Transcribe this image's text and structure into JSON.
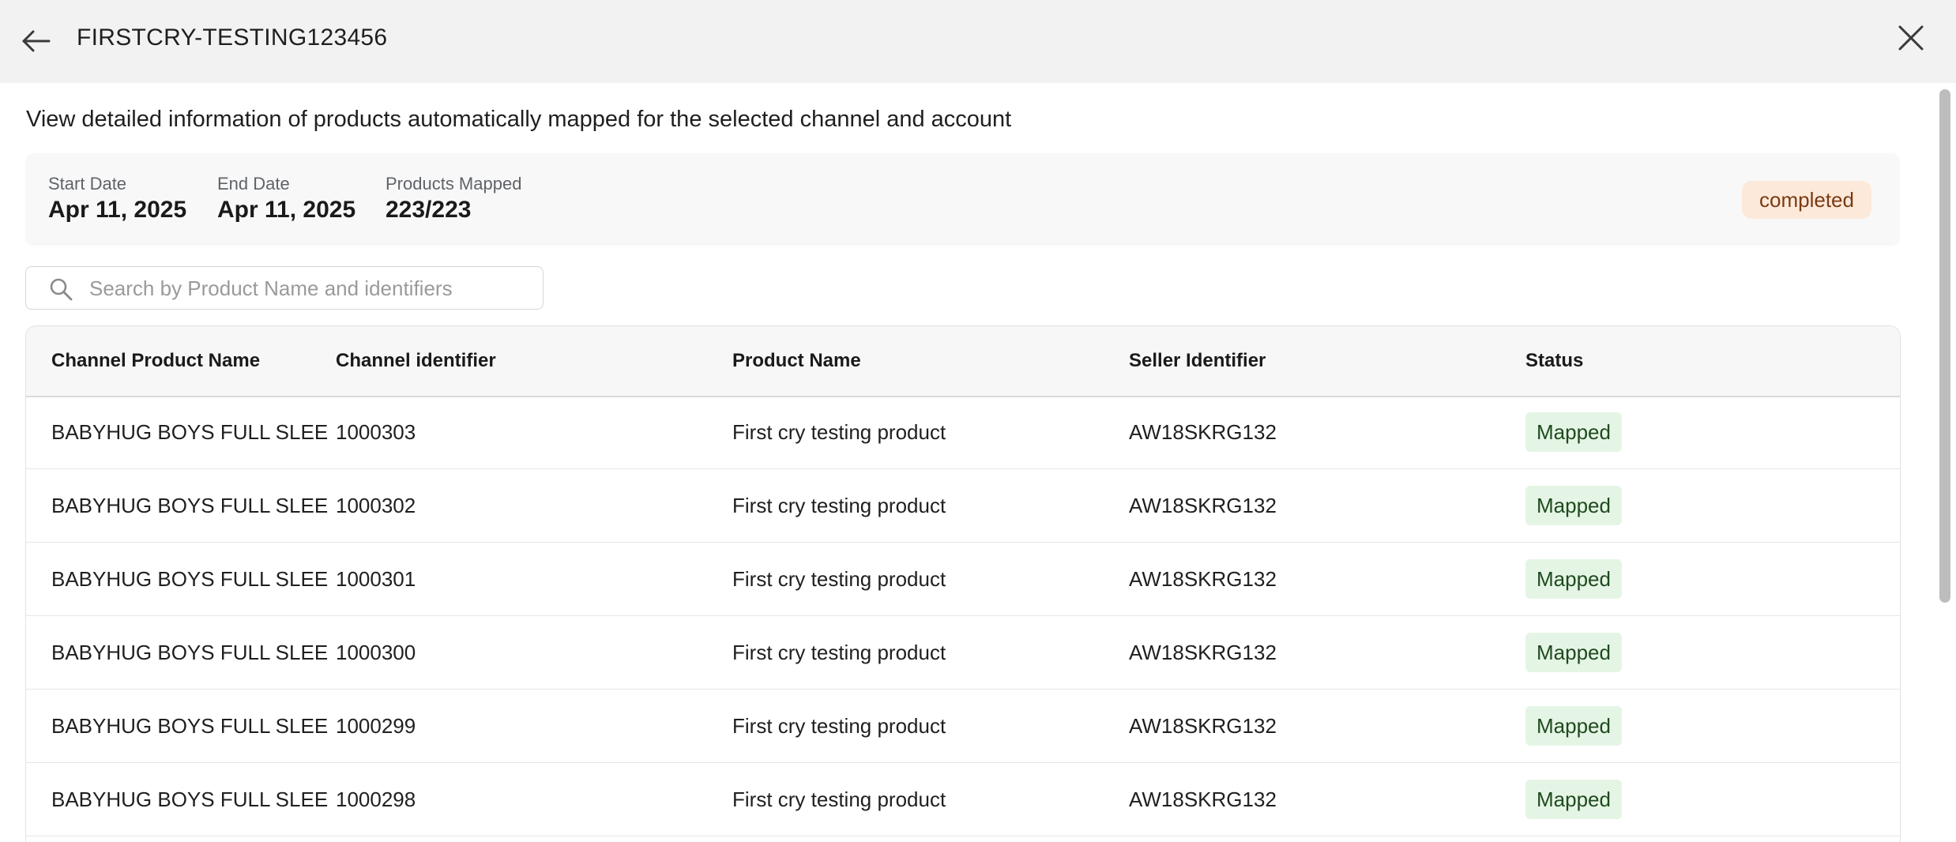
{
  "header": {
    "title": "FIRSTCRY-TESTING123456"
  },
  "description": "View detailed information of products automatically mapped for the selected channel and account",
  "summary": {
    "start_date_label": "Start Date",
    "start_date_value": "Apr 11, 2025",
    "end_date_label": "End Date",
    "end_date_value": "Apr 11, 2025",
    "products_mapped_label": "Products Mapped",
    "products_mapped_value": "223/223",
    "status": "completed"
  },
  "search": {
    "placeholder": "Search by Product Name and identifiers",
    "value": ""
  },
  "table": {
    "columns": [
      "Channel Product Name",
      "Channel identifier",
      "Product Name",
      "Seller Identifier",
      "Status"
    ],
    "rows": [
      {
        "channel_product_name": "BABYHUG BOYS FULL SLEE",
        "channel_identifier": "1000303",
        "product_name": "First cry testing product",
        "seller_identifier": "AW18SKRG132",
        "status": "Mapped"
      },
      {
        "channel_product_name": "BABYHUG BOYS FULL SLEE",
        "channel_identifier": "1000302",
        "product_name": "First cry testing product",
        "seller_identifier": "AW18SKRG132",
        "status": "Mapped"
      },
      {
        "channel_product_name": "BABYHUG BOYS FULL SLEE",
        "channel_identifier": "1000301",
        "product_name": "First cry testing product",
        "seller_identifier": "AW18SKRG132",
        "status": "Mapped"
      },
      {
        "channel_product_name": "BABYHUG BOYS FULL SLEE",
        "channel_identifier": "1000300",
        "product_name": "First cry testing product",
        "seller_identifier": "AW18SKRG132",
        "status": "Mapped"
      },
      {
        "channel_product_name": "BABYHUG BOYS FULL SLEE",
        "channel_identifier": "1000299",
        "product_name": "First cry testing product",
        "seller_identifier": "AW18SKRG132",
        "status": "Mapped"
      },
      {
        "channel_product_name": "BABYHUG BOYS FULL SLEE",
        "channel_identifier": "1000298",
        "product_name": "First cry testing product",
        "seller_identifier": "AW18SKRG132",
        "status": "Mapped"
      }
    ]
  },
  "icons": {
    "back": "arrow-left-icon",
    "close": "close-icon",
    "search": "search-icon"
  },
  "colors": {
    "header_bg": "#f2f2f2",
    "status_completed_bg": "#fde9da",
    "status_completed_text": "#7a3a12",
    "mapped_bg": "#e5f5e5",
    "mapped_text": "#1f4a1f"
  }
}
